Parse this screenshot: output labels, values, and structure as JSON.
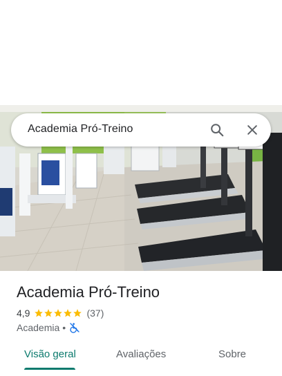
{
  "search": {
    "query": "Academia Pró-Treino"
  },
  "place": {
    "name": "Academia Pró-Treino",
    "rating": "4,9",
    "stars": 5,
    "review_count": "(37)",
    "category": "Academia",
    "separator": "•"
  },
  "tabs": [
    {
      "label": "Visão geral",
      "active": true
    },
    {
      "label": "Avaliações",
      "active": false
    },
    {
      "label": "Sobre",
      "active": false
    }
  ],
  "colors": {
    "accent": "#0b7a6d",
    "star": "#fbbc04",
    "accessibility_icon": "#1a73e8"
  },
  "icons": {
    "search": "search-icon",
    "close": "close-icon",
    "accessibility": "no-wheelchair-icon"
  }
}
